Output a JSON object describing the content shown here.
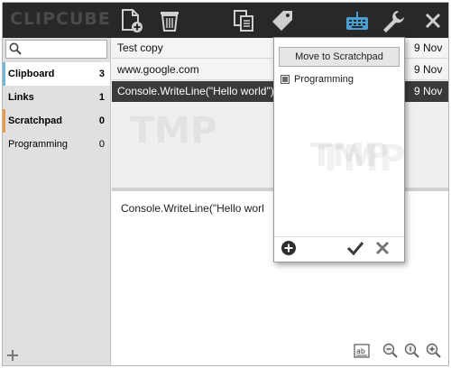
{
  "app": {
    "logo": "CLIPCUBE"
  },
  "titlebar": {
    "icons": [
      "new-clip-icon",
      "trash-icon",
      "copy-icon",
      "tag-icon",
      "keyboard-icon",
      "wrench-icon",
      "close-icon"
    ]
  },
  "search": {
    "placeholder": "",
    "icon": "search-icon"
  },
  "sidebar": {
    "folders": [
      {
        "label": "Clipboard",
        "count": "3",
        "accent": "#6fb6d8"
      },
      {
        "label": "Links",
        "count": "1",
        "accent": ""
      },
      {
        "label": "Scratchpad",
        "count": "0",
        "accent": "#e79a4a"
      },
      {
        "label": "Programming",
        "count": "0",
        "accent": ""
      }
    ],
    "add_icon": "plus-icon"
  },
  "clips": [
    {
      "text": "Test copy",
      "date": "9 Nov"
    },
    {
      "text": "www.google.com",
      "date": "9 Nov"
    },
    {
      "text": "Console.WriteLine(\"Hello world\")",
      "date": "9 Nov"
    }
  ],
  "preview": {
    "text": "Console.WriteLine(\"Hello worl"
  },
  "popup": {
    "move_label": "Move to Scratchpad",
    "folders": [
      {
        "label": "Programming"
      }
    ]
  },
  "colors": {
    "titlebar": "#282828",
    "selected_row": "#3a3a3a",
    "accent_blue": "#6fb6d8",
    "accent_orange": "#e79a4a",
    "keyboard_icon": "#4a9fd0"
  },
  "watermark": "TMP"
}
